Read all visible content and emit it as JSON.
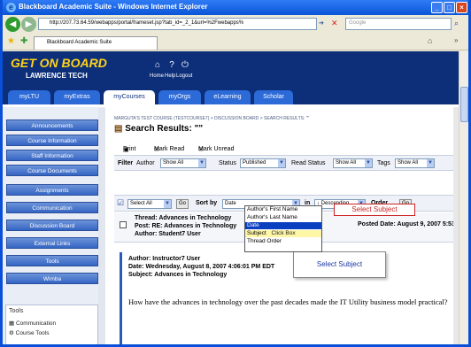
{
  "window": {
    "title": "Blackboard Academic Suite - Windows Internet Explorer",
    "url": "http://207.73.64.59/webapps/portal/frameset.jsp?tab_id=_2_1&url=%2Fwebapps%",
    "search_placeholder": "Google",
    "tab_title": "Blackboard Academic Suite"
  },
  "header": {
    "logo_line1": "GET ON BOARD",
    "logo_line2": "LAWRENCE TECH",
    "links": [
      "Home",
      "Help",
      "Logout"
    ]
  },
  "tabs": [
    "myLTU",
    "myExtras",
    "myCourses",
    "myOrgs",
    "eLearning",
    "Scholar"
  ],
  "active_tab": "myCourses",
  "left_nav": {
    "buttons": [
      "Announcements",
      "Course Information",
      "Staff Information",
      "Course Documents",
      "Assignments",
      "Communication",
      "Discussion Board",
      "External Links",
      "Tools",
      "Wimba"
    ],
    "tools": {
      "heading": "Tools",
      "items": [
        "Communication",
        "Course Tools"
      ]
    }
  },
  "main": {
    "breadcrumb": "MARGUTA'S TEST COURSE (TESTCOURSE7) > DISCUSSION BOARD > SEARCH RESULTS: \"\"",
    "title": "Search Results: \"\"",
    "actions": [
      "Print",
      "Mark Read",
      "Mark Unread"
    ],
    "filter": {
      "label": "Filter",
      "author_label": "Author",
      "author_value": "Show All",
      "status_label": "Status",
      "status_value": "Published",
      "read_label": "Read Status",
      "read_value": "Show All",
      "tags_label": "Tags",
      "tags_value": "Show All"
    },
    "sort": {
      "select_value": "Select All",
      "go_small": "Go",
      "sort_by_label": "Sort by",
      "sort_by_value": "Date",
      "in_label": "in",
      "order_value": "Descending",
      "order_label": "Order",
      "go": "Go",
      "options": [
        "Author's First Name",
        "Author's Last Name",
        "Date",
        "Subject",
        "Thread Order"
      ],
      "highlighted": "Date",
      "hover_note": "Click Box"
    },
    "thread": {
      "thread_line": "Thread: Advances in Technology",
      "post_line": "Post: RE: Advances in Technology",
      "author_line": "Author: Student7 User",
      "posted_date": "Posted Date: August 9, 2007 5:53"
    },
    "message": {
      "author": "Author: Instructor7 User",
      "date": "Date: Wednesday, August 8, 2007 4:06:01 PM EDT",
      "subject": "Subject: Advances in Technology",
      "body": "How have the advances in technology over the past decades made the IT Utility business model practical?"
    },
    "callout_red": "Select Subject",
    "callout_blue": "Select Subject"
  },
  "colors": {
    "header_bg": "#0d2f7a",
    "tab_bg": "#2c6ad8",
    "nav_button": "#3565c4",
    "callout_red": "#cc2222",
    "highlight": "#0a3fbf"
  }
}
